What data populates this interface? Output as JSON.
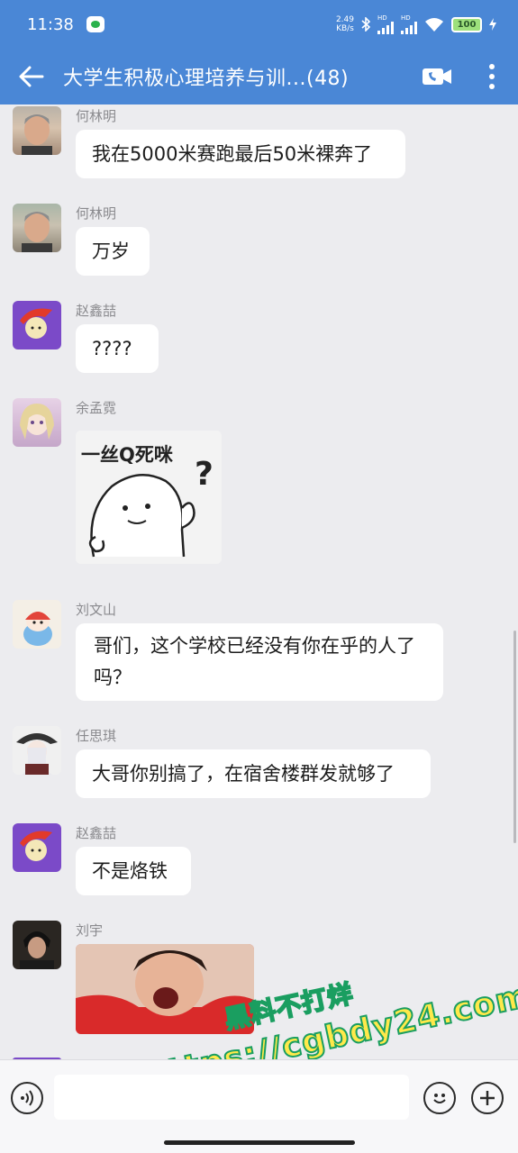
{
  "status": {
    "time": "11:38",
    "net_speed_value": "2.49",
    "net_speed_unit": "KB/s",
    "hd1": "HD",
    "hd2": "HD",
    "battery": "100"
  },
  "header": {
    "title": "大学生积极心理培养与训...(48)"
  },
  "messages": [
    {
      "sender": "何林明",
      "text": "我在5000米赛跑最后50米裸奔了"
    },
    {
      "sender": "何林明",
      "text": "万岁"
    },
    {
      "sender": "赵鑫喆",
      "text": "????"
    },
    {
      "sender": "余孟霓",
      "sticker_text": "一丝Q死咪",
      "sticker_mark": "?"
    },
    {
      "sender": "刘文山",
      "text": "哥们，这个学校已经没有你在乎的人了吗？"
    },
    {
      "sender": "任思琪",
      "text": "大哥你别搞了，在宿舍楼群发就够了"
    },
    {
      "sender": "赵鑫喆",
      "text": "不是烙铁"
    },
    {
      "sender": "刘宇"
    }
  ],
  "input": {
    "placeholder": ""
  },
  "overlay": {
    "line1": "黑料不打烊",
    "line2": "https://cgbdy24.com"
  }
}
